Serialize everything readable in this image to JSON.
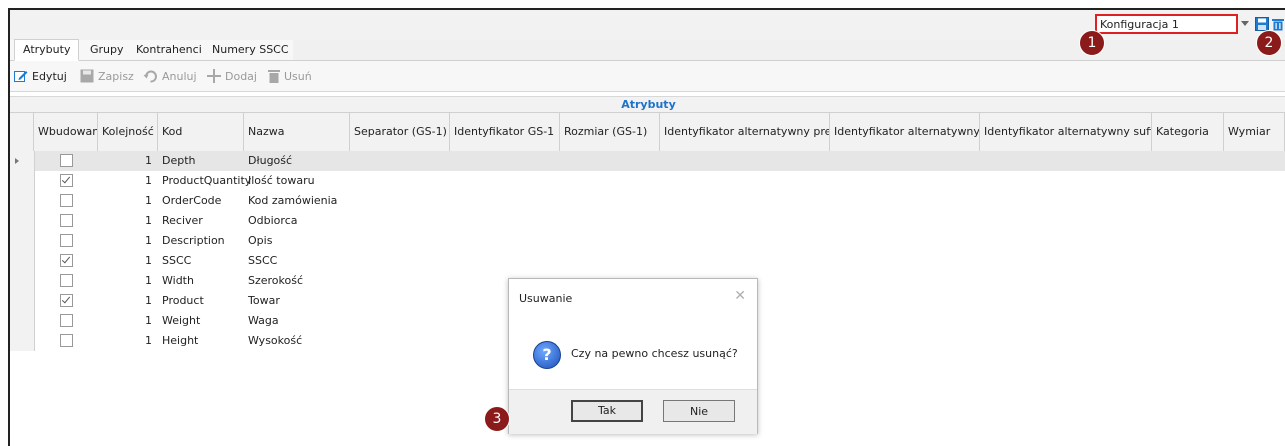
{
  "config": {
    "selected": "Konfiguracja 1"
  },
  "callouts": [
    "1",
    "2",
    "3"
  ],
  "tabs": [
    {
      "label": "Atrybuty",
      "active": true
    },
    {
      "label": "Grupy"
    },
    {
      "label": "Kontrahenci"
    },
    {
      "label": "Numery SSCC"
    }
  ],
  "toolbar": {
    "edit": "Edytuj",
    "save": "Zapisz",
    "cancel": "Anuluj",
    "add": "Dodaj",
    "delete": "Usuń"
  },
  "grid": {
    "group_title": "Atrybuty",
    "columns": [
      "Wbudowany",
      "Kolejność",
      "Kod",
      "Nazwa",
      "Separator (GS-1)",
      "Identyfikator GS-1",
      "Rozmiar (GS-1)",
      "Identyfikator alternatywny prefix",
      "Identyfikator alternatywny",
      "Identyfikator alternatywny suffix",
      "Kategoria",
      "Wymiar"
    ],
    "rows": [
      {
        "built_in": false,
        "order": "1",
        "code": "Depth",
        "name": "Długość",
        "selected": true
      },
      {
        "built_in": true,
        "order": "1",
        "code": "ProductQuantity",
        "name": "Ilość towaru"
      },
      {
        "built_in": false,
        "order": "1",
        "code": "OrderCode",
        "name": "Kod zamówienia"
      },
      {
        "built_in": false,
        "order": "1",
        "code": "Reciver",
        "name": "Odbiorca"
      },
      {
        "built_in": false,
        "order": "1",
        "code": "Description",
        "name": "Opis"
      },
      {
        "built_in": true,
        "order": "1",
        "code": "SSCC",
        "name": "SSCC"
      },
      {
        "built_in": false,
        "order": "1",
        "code": "Width",
        "name": "Szerokość"
      },
      {
        "built_in": true,
        "order": "1",
        "code": "Product",
        "name": "Towar"
      },
      {
        "built_in": false,
        "order": "1",
        "code": "Weight",
        "name": "Waga"
      },
      {
        "built_in": false,
        "order": "1",
        "code": "Height",
        "name": "Wysokość"
      }
    ]
  },
  "dialog": {
    "title": "Usuwanie",
    "message": "Czy na pewno chcesz usunąć?",
    "yes": "Tak",
    "no": "Nie"
  }
}
